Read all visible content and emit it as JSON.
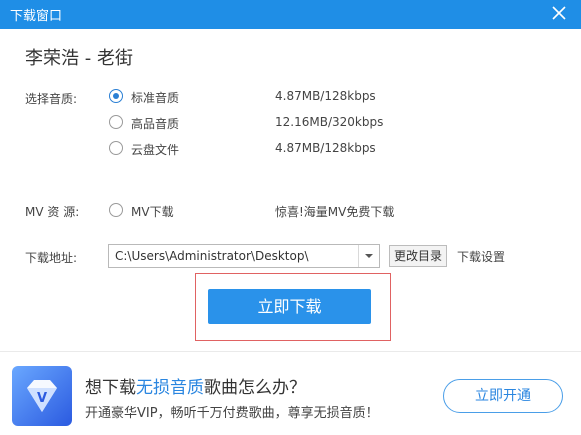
{
  "window": {
    "title": "下载窗口",
    "close_icon": "close-icon"
  },
  "song": {
    "title": "李荣浩 - 老街"
  },
  "quality": {
    "label": "选择音质:",
    "options": [
      {
        "label": "标准音质",
        "size": "4.87MB/128kbps",
        "checked": true
      },
      {
        "label": "高品音质",
        "size": "12.16MB/320kbps",
        "checked": false
      },
      {
        "label": "云盘文件",
        "size": "4.87MB/128kbps",
        "checked": false
      }
    ]
  },
  "mv": {
    "label": "MV 资 源:",
    "option_label": "MV下载",
    "note": "惊喜!海量MV免费下载"
  },
  "path": {
    "label": "下载地址:",
    "value": "C:\\Users\\Administrator\\Desktop\\",
    "change_dir_label": "更改目录",
    "settings_label": "下载设置"
  },
  "actions": {
    "download_label": "立即下载"
  },
  "promo": {
    "title_prefix": "想下载",
    "title_highlight": "无损音质",
    "title_suffix": "歌曲怎么办？",
    "subtitle": "开通豪华VIP，畅听千万付费歌曲，尊享无损音质！",
    "button_label": "立即开通",
    "icon": "diamond-v-icon"
  },
  "colors": {
    "titlebar": "#1f8ee6",
    "accent": "#2a92ea",
    "highlight_border": "#e06262"
  }
}
